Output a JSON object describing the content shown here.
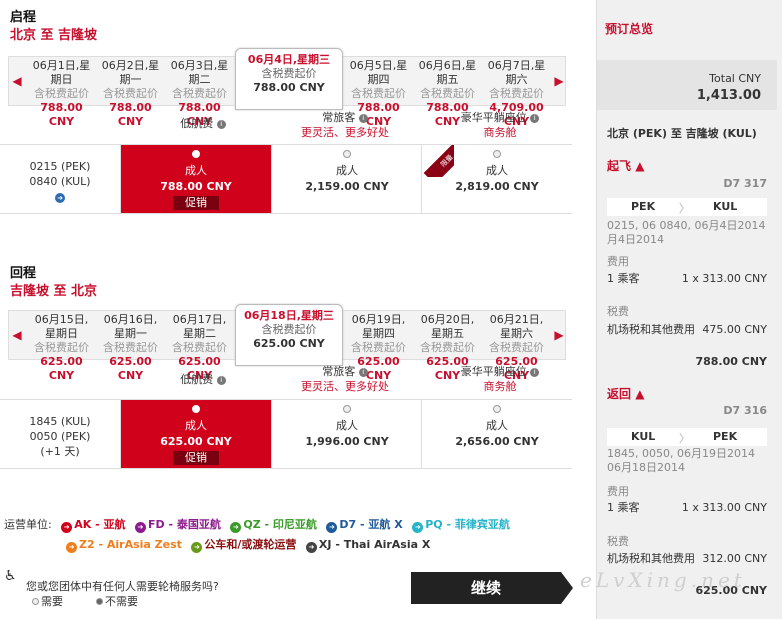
{
  "outbound": {
    "heading": "启程",
    "route": "北京 至 吉隆坡",
    "dates": [
      {
        "l1": "06月1日,星",
        "l2": "期日",
        "tax": "含税费起价",
        "price": "788.00 CNY"
      },
      {
        "l1": "06月2日,星",
        "l2": "期一",
        "tax": "含税费起价",
        "price": "788.00 CNY"
      },
      {
        "l1": "06月3日,星",
        "l2": "期二",
        "tax": "含税费起价",
        "price": "788.00 CNY"
      },
      {
        "l1": "06月5日,星",
        "l2": "期四",
        "tax": "含税费起价",
        "price": "788.00 CNY"
      },
      {
        "l1": "06月6日,星",
        "l2": "期五",
        "tax": "含税费起价",
        "price": "788.00 CNY"
      },
      {
        "l1": "06月7日,星",
        "l2": "期六",
        "tax": "含税费起价",
        "price": "4,709.00 CNY"
      }
    ],
    "selected": {
      "l1": "06月4日,星期三",
      "tax": "含税费起价",
      "price": "788.00 CNY"
    },
    "flight": {
      "dep": "0215 (PEK)",
      "arr": "0840 (KUL)"
    },
    "fares": [
      {
        "pax": "成人",
        "price": "788.00 CNY",
        "promo": "促销"
      },
      {
        "pax": "成人",
        "price": "2,159.00 CNY"
      },
      {
        "pax": "成人",
        "price": "2,819.00 CNY"
      }
    ]
  },
  "return": {
    "heading": "回程",
    "route": "吉隆坡 至 北京",
    "dates": [
      {
        "l1": "06月15日,",
        "l2": "星期日",
        "tax": "含税费起价",
        "price": "625.00 CNY"
      },
      {
        "l1": "06月16日,",
        "l2": "星期一",
        "tax": "含税费起价",
        "price": "625.00 CNY"
      },
      {
        "l1": "06月17日,",
        "l2": "星期二",
        "tax": "含税费起价",
        "price": "625.00 CNY"
      },
      {
        "l1": "06月19日,",
        "l2": "星期四",
        "tax": "含税费起价",
        "price": "625.00 CNY"
      },
      {
        "l1": "06月20日,",
        "l2": "星期五",
        "tax": "含税费起价",
        "price": "625.00 CNY"
      },
      {
        "l1": "06月21日,",
        "l2": "星期六",
        "tax": "含税费起价",
        "price": "625.00 CNY"
      }
    ],
    "selected": {
      "l1": "06月18日,星期三",
      "tax": "含税费起价",
      "price": "625.00 CNY"
    },
    "flight": {
      "dep": "1845 (KUL)",
      "arr": "0050 (PEK)",
      "next": "(+1 天)"
    },
    "fares": [
      {
        "pax": "成人",
        "price": "625.00 CNY",
        "promo": "促销"
      },
      {
        "pax": "成人",
        "price": "1,996.00 CNY"
      },
      {
        "pax": "成人",
        "price": "2,656.00 CNY"
      }
    ]
  },
  "fare_types": {
    "low": "低航费",
    "regular": "常旅客",
    "regular_sub": "更灵活、更多好处",
    "premium": "豪华平躺座位",
    "premium_sub": "商务舱",
    "corner_tag": "限量"
  },
  "operators": {
    "label": "运营单位:",
    "items": [
      {
        "code": "AK",
        "name": "AK - 亚航",
        "color": "#d0021b"
      },
      {
        "code": "FD",
        "name": "FD - 泰国亚航",
        "color": "#8e1b8e"
      },
      {
        "code": "QZ",
        "name": "QZ - 印尼亚航",
        "color": "#3a9a2a"
      },
      {
        "code": "D7",
        "name": "D7 - 亚航 X",
        "color": "#1f5a9a"
      },
      {
        "code": "PQ",
        "name": "PQ - 菲律宾亚航",
        "color": "#27b3c8"
      },
      {
        "code": "Z2",
        "name": "Z2 - AirAsia Zest",
        "color": "#f07d1c"
      },
      {
        "code": "bus",
        "name": "公车和/或渡轮运营",
        "color": "#6a9a1a"
      },
      {
        "code": "XJ",
        "name": "XJ - Thai AirAsia X",
        "color": "#444444"
      }
    ]
  },
  "wheelchair": {
    "question": "您或您团体中有任何人需要轮椅服务吗?",
    "yes": "需要",
    "no": "不需要"
  },
  "continue_label": "继续",
  "watermark": "eLvXing.net",
  "summary": {
    "title": "预订总览",
    "total_label": "Total CNY",
    "total": "1,413.00",
    "route": "北京 (PEK) 至 吉隆坡 (KUL)",
    "depart": {
      "label": "起飞",
      "flight": "D7 317",
      "from": "PEK",
      "to": "KUL",
      "times": "0215, 06 0840, 06月4日2014",
      "date": "月4日2014",
      "fee_label": "费用",
      "pax": "1 乘客",
      "pax_fee": "1 x 313.00 CNY",
      "tax_label": "税费",
      "tax_item": "机场税和其他费用",
      "tax_val": "475.00 CNY",
      "subtotal": "788.00 CNY"
    },
    "ret": {
      "label": "返回",
      "flight": "D7 316",
      "from": "KUL",
      "to": "PEK",
      "times": "1845, 0050, 06月19日2014",
      "date": "06月18日2014",
      "fee_label": "费用",
      "pax": "1 乘客",
      "pax_fee": "1 x 313.00 CNY",
      "tax_label": "税费",
      "tax_item": "机场税和其他费用",
      "tax_val": "312.00 CNY",
      "subtotal": "625.00 CNY"
    }
  }
}
